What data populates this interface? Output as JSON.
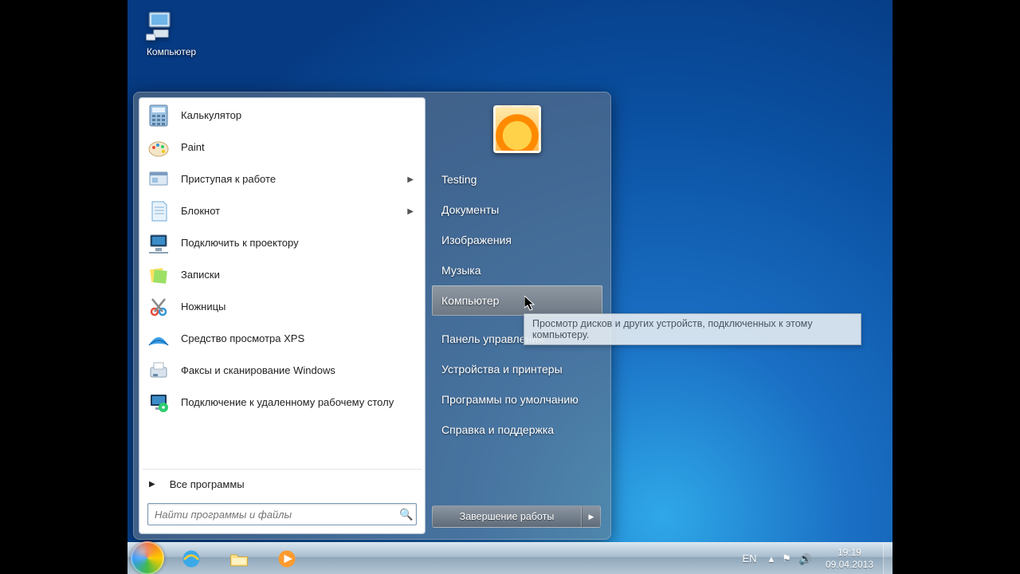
{
  "desktop": {
    "computer_label": "Компьютер"
  },
  "start": {
    "apps": [
      {
        "label": "Калькулятор",
        "icon": "calculator",
        "submenu": false
      },
      {
        "label": "Paint",
        "icon": "paint",
        "submenu": false
      },
      {
        "label": "Приступая к работе",
        "icon": "getting-started",
        "submenu": true
      },
      {
        "label": "Блокнот",
        "icon": "notepad",
        "submenu": true
      },
      {
        "label": "Подключить к проектору",
        "icon": "projector",
        "submenu": false
      },
      {
        "label": "Записки",
        "icon": "sticky-notes",
        "submenu": false
      },
      {
        "label": "Ножницы",
        "icon": "snipping",
        "submenu": false
      },
      {
        "label": "Средство просмотра XPS",
        "icon": "xps-viewer",
        "submenu": false
      },
      {
        "label": "Факсы и сканирование Windows",
        "icon": "fax-scan",
        "submenu": false
      },
      {
        "label": "Подключение к удаленному рабочему столу",
        "icon": "remote-desktop",
        "submenu": false
      }
    ],
    "all_programs": "Все программы",
    "search_placeholder": "Найти программы и файлы",
    "right": [
      "Testing",
      "Документы",
      "Изображения",
      "Музыка",
      "Компьютер",
      "Панель управления",
      "Устройства и принтеры",
      "Программы по умолчанию",
      "Справка и поддержка"
    ],
    "right_hover_index": 4,
    "shutdown_label": "Завершение работы"
  },
  "tooltip": {
    "text": "Просмотр дисков и других устройств, подключенных к этому компьютеру."
  },
  "taskbar": {
    "lang": "EN",
    "time": "19:19",
    "date": "09.04.2013"
  }
}
